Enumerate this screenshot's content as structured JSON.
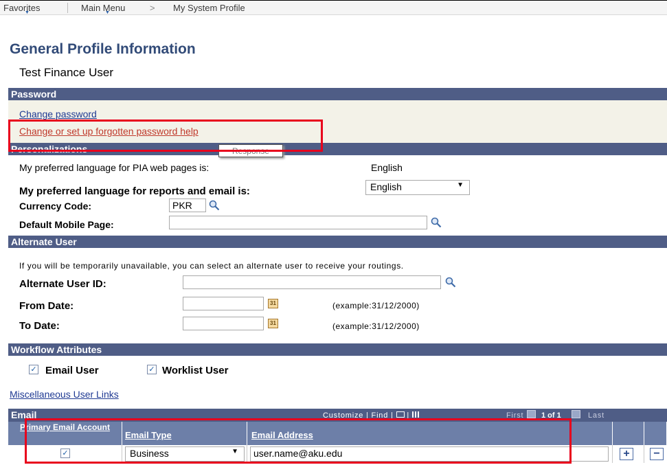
{
  "topbar": {
    "favorites": "Favorites",
    "main_menu": "Main Menu",
    "separator": ">",
    "breadcrumb_current": "My System Profile"
  },
  "page": {
    "title": "General Profile Information",
    "user_name": "Test Finance User"
  },
  "password": {
    "header": "Password",
    "change_password": "Change password",
    "forgotten_help": "Change or set up forgotten password help",
    "tooltip": "Response"
  },
  "personalizations": {
    "header": "Personalizations",
    "pia_label": "My preferred language for PIA web pages is:",
    "pia_value": "English",
    "reports_label": "My preferred language for reports and email is:",
    "reports_value": "English",
    "currency_label": "Currency Code:",
    "currency_value": "PKR",
    "mobile_label": "Default Mobile Page:",
    "mobile_value": ""
  },
  "alternate": {
    "header": "Alternate User",
    "info": "If you will be temporarily unavailable, you can select an alternate user to receive your routings.",
    "user_id_label": "Alternate User ID:",
    "from_label": "From Date:",
    "to_label": "To Date:",
    "example": "(example:31/12/2000)",
    "calendar_icon_text": "31"
  },
  "workflow": {
    "header": "Workflow Attributes",
    "email_user": "Email User",
    "email_user_checked": true,
    "worklist_user": "Worklist User",
    "worklist_user_checked": true
  },
  "misc_link": "Miscellaneous User Links",
  "email": {
    "header": "Email",
    "customize": "Customize",
    "find": "Find",
    "first": "First",
    "pager": "1 of 1",
    "last": "Last",
    "columns": [
      "Primary Email Account",
      "Email Type",
      "Email Address"
    ],
    "rows": [
      {
        "primary": true,
        "type": "Business",
        "address": "user.name@aku.edu"
      }
    ]
  },
  "colors": {
    "section_bar": "#4f5d86",
    "title": "#324b78",
    "highlight": "#e8001c",
    "link": "#1f3a93"
  }
}
